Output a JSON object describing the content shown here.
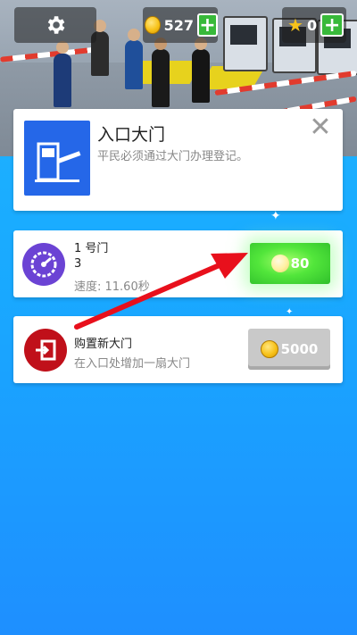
{
  "hud": {
    "coins": "527",
    "stars": "0",
    "coin_add_label": "+",
    "star_add_label": "+"
  },
  "entrance_card": {
    "title": "入口大门",
    "description": "平民必须通过大门办理登记。",
    "close_label": "✕"
  },
  "gate_card": {
    "name": "1 号门",
    "level": "3",
    "speed": "速度: 11.60秒",
    "upgrade_price": "80"
  },
  "buy_card": {
    "title": "购置新大门",
    "description": "在入口处增加一扇大门",
    "price": "5000"
  },
  "colors": {
    "accent_green": "#38b93a",
    "gate_blue": "#2567e8",
    "speed_purple": "#6b43d4",
    "exit_red": "#c0101a",
    "arrow_red": "#e8101c"
  }
}
